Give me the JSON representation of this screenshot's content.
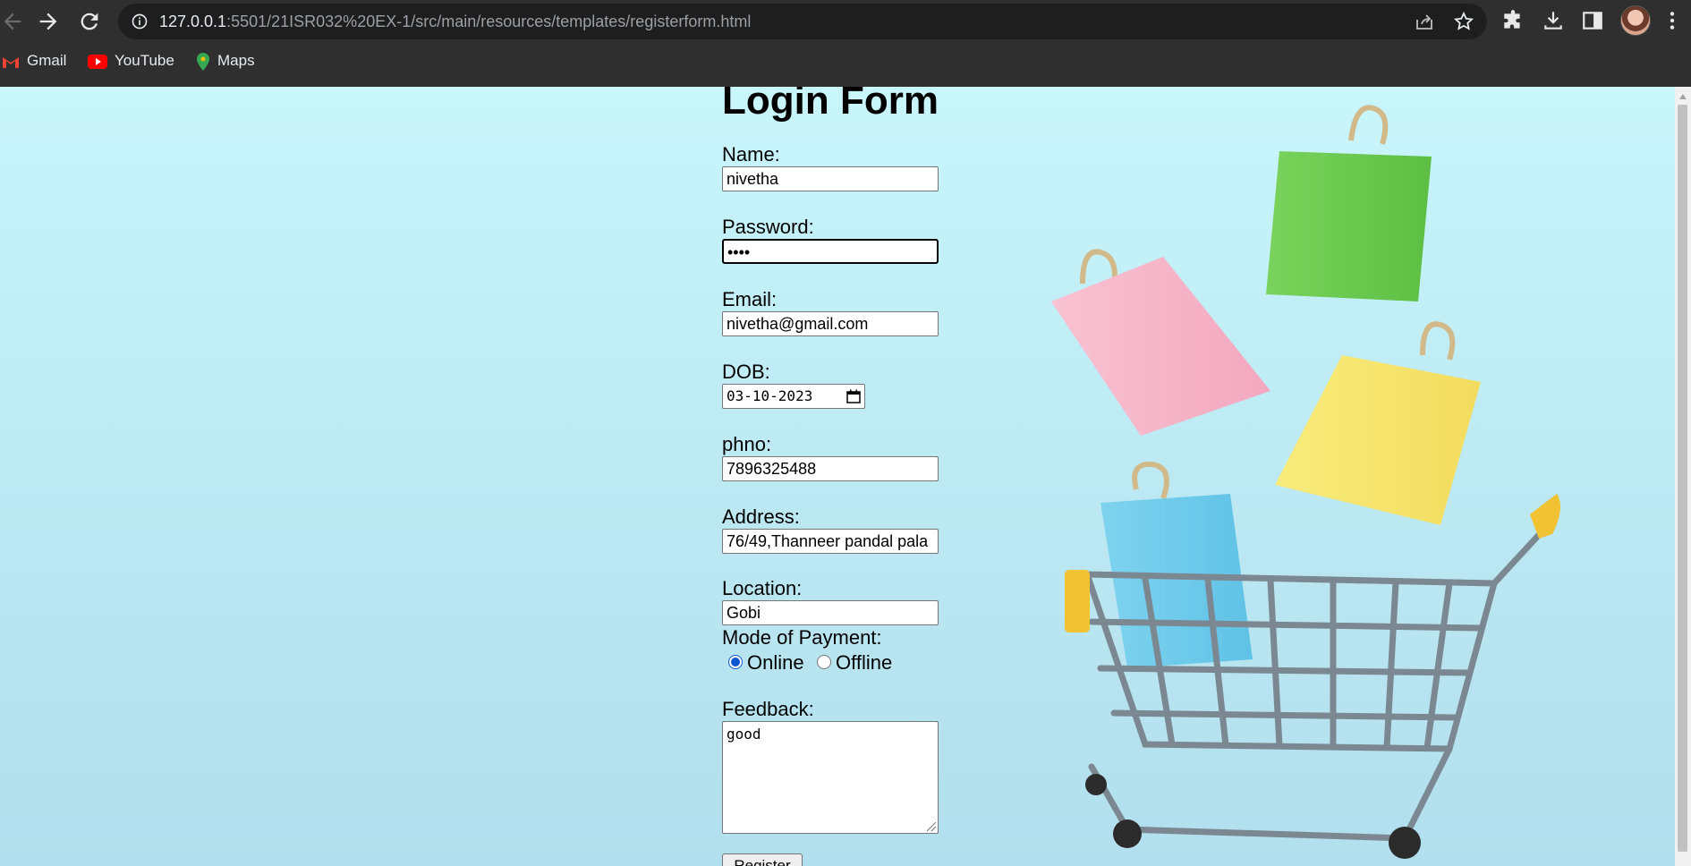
{
  "browser": {
    "url_host": "127.0.0.1",
    "url_path": ":5501/21ISR032%20EX-1/src/main/resources/templates/registerform.html",
    "bookmarks": [
      "Gmail",
      "YouTube",
      "Maps"
    ]
  },
  "form": {
    "title": "Login Form",
    "name_label": "Name:",
    "name_value": "nivetha",
    "password_label": "Password:",
    "password_value": "••••",
    "email_label": "Email:",
    "email_value": "nivetha@gmail.com",
    "dob_label": "DOB:",
    "dob_value": "03-10-2023",
    "phno_label": "phno:",
    "phno_value": "7896325488",
    "address_label": "Address:",
    "address_value": "76/49,Thanneer pandal pala",
    "location_label": "Location:",
    "location_value": "Gobi",
    "payment_label": "Mode of Payment:",
    "payment_options": [
      "Online",
      "Offline"
    ],
    "payment_selected": "Online",
    "feedback_label": "Feedback:",
    "feedback_value": "good",
    "register_label": "Register"
  },
  "colors": {
    "page_background": "#c9f6fb",
    "chrome": "#2f2f2f",
    "radio_accent": "#0b57d0"
  }
}
